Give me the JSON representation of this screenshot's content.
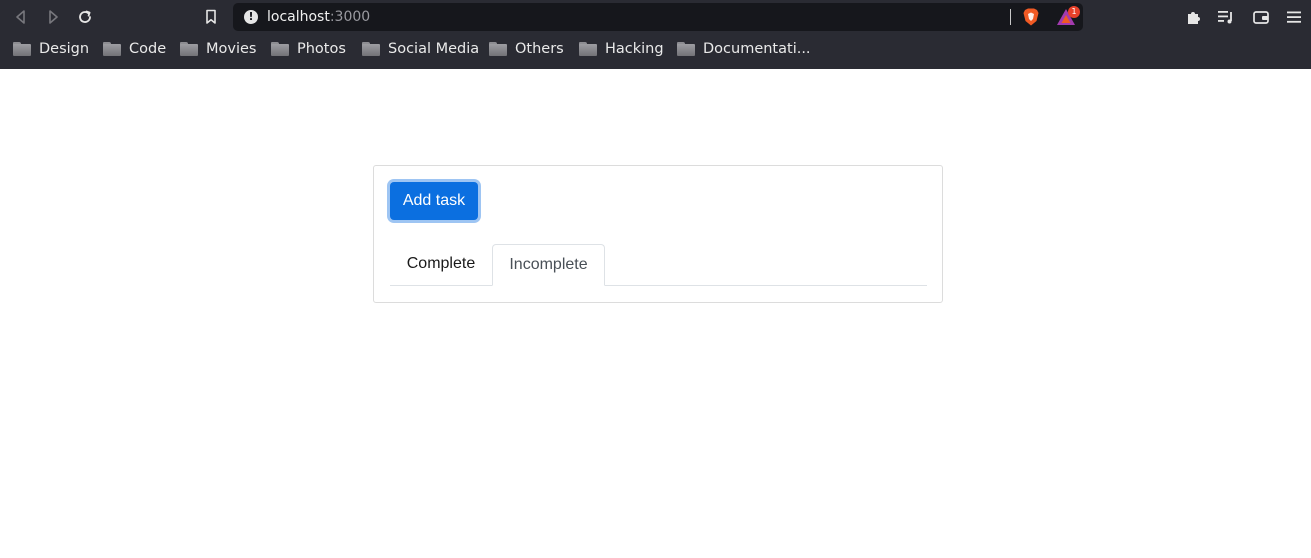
{
  "browser": {
    "url_host": "localhost",
    "url_port": ":3000",
    "rewards_badge": "1",
    "bookmarks": [
      "Design",
      "Code",
      "Movies",
      "Photos",
      "Social Media",
      "Others",
      "Hacking",
      "Documentati..."
    ]
  },
  "app": {
    "add_task_label": "Add task",
    "tabs": [
      {
        "label": "Complete",
        "active": false
      },
      {
        "label": "Incomplete",
        "active": true
      }
    ]
  },
  "colors": {
    "chrome_bg": "#2a2b33",
    "urlbar_bg": "#16171c",
    "primary": "#0b6fe0",
    "brave_orange": "#f15a24",
    "badge_red": "#e8412a"
  },
  "icons": {
    "back": "back-icon",
    "forward": "forward-icon",
    "reload": "reload-icon",
    "bookmark": "bookmark-icon",
    "site_info": "info-icon",
    "brave_shields": "brave-shield-icon",
    "rewards": "brave-rewards-icon",
    "extensions": "puzzle-icon",
    "playlist": "playlist-icon",
    "wallet": "wallet-icon",
    "menu": "hamburger-menu-icon",
    "folder": "folder-icon"
  }
}
